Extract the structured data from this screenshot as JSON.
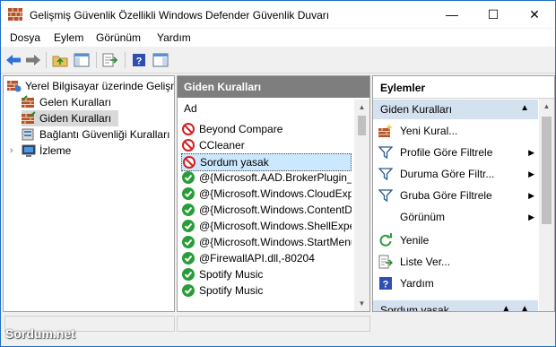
{
  "window": {
    "title": "Gelişmiş Güvenlik Özellikli Windows Defender Güvenlik Duvarı",
    "controls": {
      "minimize": "—",
      "maximize": "☐",
      "close": "✕"
    }
  },
  "menu": [
    {
      "label": "Dosya"
    },
    {
      "label": "Eylem"
    },
    {
      "label": "Görünüm"
    },
    {
      "label": "Yardım"
    }
  ],
  "tree": {
    "root": "Yerel Bilgisayar üzerinde Gelişm",
    "items": [
      {
        "label": "Gelen Kuralları"
      },
      {
        "label": "Giden Kuralları"
      },
      {
        "label": "Bağlantı Güvenliği Kuralları"
      },
      {
        "label": "İzleme"
      }
    ]
  },
  "middle": {
    "header": "Giden Kuralları",
    "column": "Ad",
    "rules": [
      {
        "label": "Beyond Compare",
        "status": "blocked"
      },
      {
        "label": "CCleaner",
        "status": "blocked"
      },
      {
        "label": "Sordum yasak",
        "status": "blocked"
      },
      {
        "label": "@{Microsoft.AAD.BrokerPlugin_1",
        "status": "allowed"
      },
      {
        "label": "@{Microsoft.Windows.CloudExp",
        "status": "allowed"
      },
      {
        "label": "@{Microsoft.Windows.ContentD",
        "status": "allowed"
      },
      {
        "label": "@{Microsoft.Windows.ShellExpe",
        "status": "allowed"
      },
      {
        "label": "@{Microsoft.Windows.StartMenu",
        "status": "allowed"
      },
      {
        "label": "@FirewallAPI.dll,-80204",
        "status": "allowed"
      },
      {
        "label": "Spotify Music",
        "status": "allowed"
      },
      {
        "label": "Spotify Music",
        "status": "allowed"
      }
    ]
  },
  "actions": {
    "header": "Eylemler",
    "section1": "Giden Kuralları",
    "items": [
      {
        "label": "Yeni Kural...",
        "submenu": false
      },
      {
        "label": "Profile Göre Filtrele",
        "submenu": true
      },
      {
        "label": "Duruma Göre Filtr...",
        "submenu": true
      },
      {
        "label": "Gruba Göre Filtrele",
        "submenu": true
      },
      {
        "label": "Görünüm",
        "submenu": true
      },
      {
        "label": "Yenile",
        "submenu": false
      },
      {
        "label": "Liste Ver...",
        "submenu": false
      },
      {
        "label": "Yardım",
        "submenu": false
      }
    ],
    "section2": "Sordum yasak"
  },
  "watermark": "Sordum.net",
  "colors": {
    "blocked": "#d32020",
    "allowed": "#2a9d3a",
    "selection": "#cce8ff",
    "header_gray": "#7e7e7e",
    "section_blue": "#d4e1ef"
  }
}
